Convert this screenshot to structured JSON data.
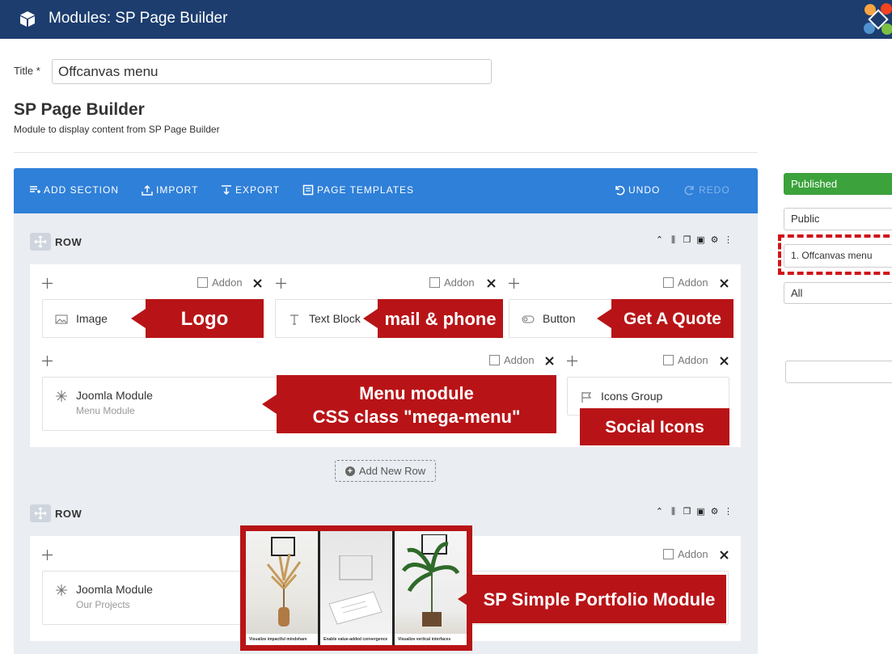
{
  "header": {
    "title": "Modules: SP Page Builder"
  },
  "form": {
    "title_label": "Title *",
    "title_value": "Offcanvas menu"
  },
  "module": {
    "heading": "SP Page Builder",
    "description": "Module to display content from SP Page Builder"
  },
  "toolbar": {
    "add_section": "ADD SECTION",
    "import": "IMPORT",
    "export": "EXPORT",
    "page_templates": "PAGE TEMPLATES",
    "undo": "UNDO",
    "redo": "REDO"
  },
  "rows": [
    {
      "label": "ROW",
      "addon_label": "Addon",
      "addons": [
        {
          "name": "Image"
        },
        {
          "name": "Text Block"
        },
        {
          "name": "Button"
        },
        {
          "name": "Joomla Module",
          "sub": "Menu Module"
        },
        {
          "name": "Icons Group"
        }
      ]
    },
    {
      "label": "ROW",
      "addon_label": "Addon",
      "addons": [
        {
          "name": "Joomla Module",
          "sub": "Our Projects"
        }
      ]
    }
  ],
  "add_new_row": "Add New Row",
  "callouts": {
    "logo": "Logo",
    "mail_phone": "mail & phone",
    "quote": "Get A Quote",
    "menu_line1": "Menu module",
    "menu_line2": "CSS class \"mega-menu\"",
    "social": "Social Icons",
    "portfolio": "SP Simple Portfolio Module"
  },
  "portfolio_captions": [
    "Visualize impactful mindshare",
    "Enable value-added convergence",
    "Visualize vertical interfaces"
  ],
  "sidebar": {
    "status": "Published",
    "access": "Public",
    "position": "1. Offcanvas menu",
    "language": "All",
    "empty": ""
  },
  "colors": {
    "header": "#1c3d6e",
    "toolbar": "#2f80d9",
    "callout": "#b81417",
    "published": "#3ca33c"
  }
}
